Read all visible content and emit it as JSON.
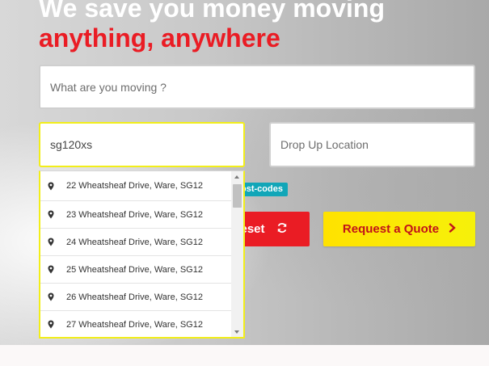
{
  "hero": {
    "title_line1": "We save you money moving",
    "title_line2": "anything, anywhere"
  },
  "form": {
    "moving_placeholder": "What are you moving ?",
    "pickup_value": "sg120xs",
    "drop_placeholder": "Drop Up Location",
    "hint_text": "ost-codes",
    "reset_label": "eset",
    "quote_label": "Request a Quote"
  },
  "suggestions": [
    "22 Wheatsheaf Drive, Ware, SG12",
    "23 Wheatsheaf Drive, Ware, SG12",
    "24 Wheatsheaf Drive, Ware, SG12",
    "25 Wheatsheaf Drive, Ware, SG12",
    "26 Wheatsheaf Drive, Ware, SG12",
    "27 Wheatsheaf Drive, Ware, SG12"
  ],
  "colors": {
    "accent_red": "#ea1c24",
    "accent_yellow": "#f6f10a",
    "hint_teal": "#11a6b8"
  },
  "icons": {
    "suggestion": "map-marker-icon",
    "reset": "refresh-icon",
    "quote": "chevron-right-icon"
  }
}
